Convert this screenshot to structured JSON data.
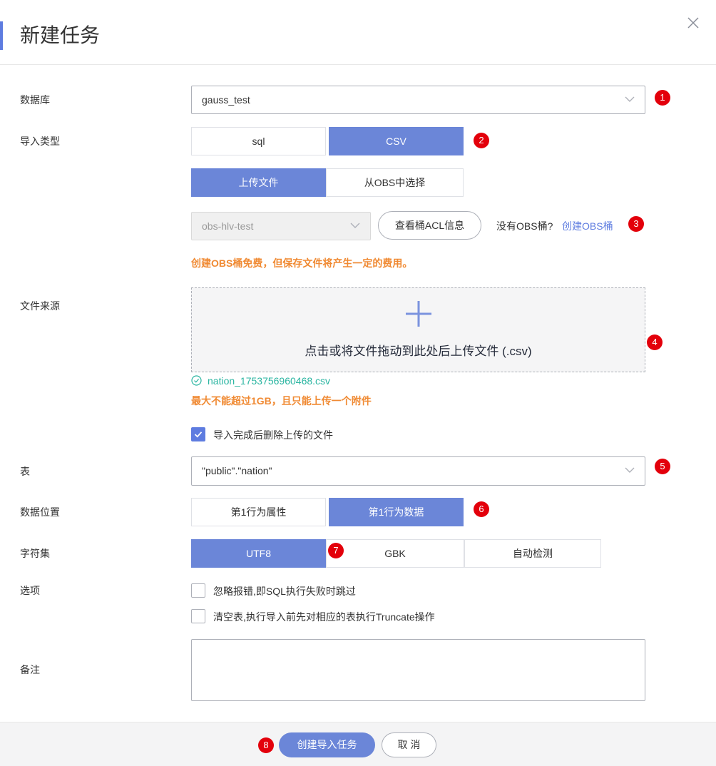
{
  "dialog": {
    "title": "新建任务"
  },
  "database": {
    "label": "数据库",
    "value": "gauss_test",
    "marker": "1"
  },
  "import_type": {
    "label": "导入类型",
    "options": [
      "sql",
      "CSV"
    ],
    "selected": "CSV",
    "marker": "2"
  },
  "file_source": {
    "label": "文件来源",
    "tabs": [
      "上传文件",
      "从OBS中选择"
    ],
    "selected_tab": "上传文件",
    "bucket_value": "obs-hlv-test",
    "acl_button": "查看桶ACL信息",
    "no_bucket_text": "没有OBS桶?",
    "create_bucket_link": "创建OBS桶",
    "marker_bucket": "3",
    "bucket_warning": "创建OBS桶免费，但保存文件将产生一定的费用。",
    "upload_text": "点击或将文件拖动到此处后上传文件 (.csv)",
    "marker_upload": "4",
    "uploaded_file": "nation_1753756960468.csv",
    "size_warning": "最大不能超过1GB，且只能上传一个附件",
    "delete_after_label": "导入完成后删除上传的文件",
    "delete_after_checked": true
  },
  "table": {
    "label": "表",
    "value": "\"public\".\"nation\"",
    "marker": "5"
  },
  "data_position": {
    "label": "数据位置",
    "options": [
      "第1行为属性",
      "第1行为数据"
    ],
    "selected": "第1行为数据",
    "marker": "6"
  },
  "charset": {
    "label": "字符集",
    "options": [
      "UTF8",
      "GBK",
      "自动检测"
    ],
    "selected": "UTF8",
    "marker": "7"
  },
  "options": {
    "label": "选项",
    "ignore_errors": "忽略报错,即SQL执行失败时跳过",
    "truncate": "清空表,执行导入前先对相应的表执行Truncate操作"
  },
  "remark": {
    "label": "备注",
    "value": ""
  },
  "footer": {
    "create_button": "创建导入任务",
    "cancel_button": "取 消",
    "marker": "8"
  },
  "colors": {
    "accent": "#5e7ce0",
    "selected": "#6b86d8",
    "warning": "#f08a33",
    "success": "#2ab5a1",
    "marker": "#e3000b"
  }
}
